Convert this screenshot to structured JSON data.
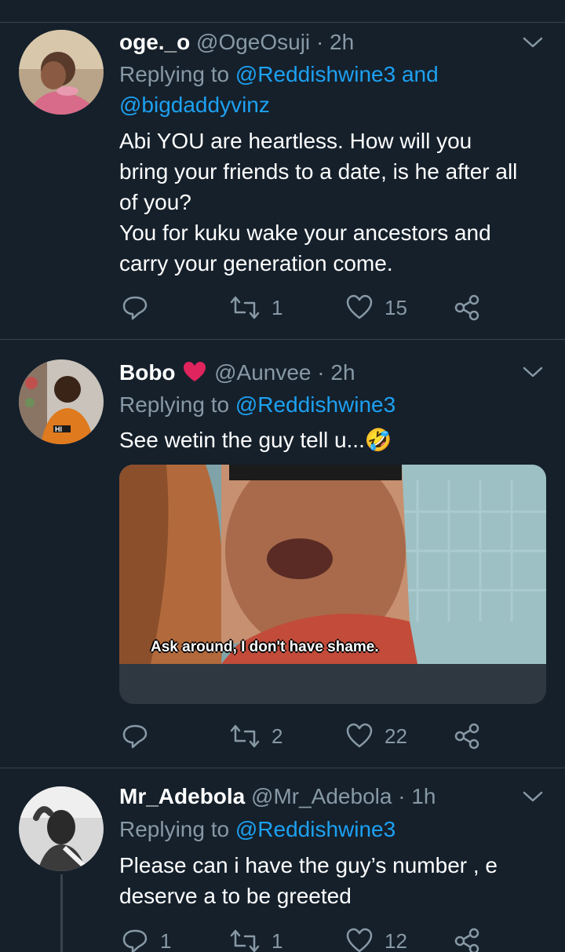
{
  "tweets": [
    {
      "name": "oge._o",
      "handle": "@OgeOsuji",
      "time": "· 2h",
      "replying_prefix": "Replying to ",
      "replying_mentions": "@Reddishwine3 and",
      "replying_mentions_2": "@bigdaddyvinz",
      "body": [
        "Abi YOU are heartless. How will you",
        "bring your friends to a date, is he after all",
        "of you?",
        "You for kuku wake your ancestors and",
        "carry your generation come."
      ],
      "retweets": "1",
      "likes": "15",
      "replies": ""
    },
    {
      "name": "Bobo",
      "name_emoji": "❤️",
      "handle": "@Aunvee",
      "time": "· 2h",
      "replying_prefix": "Replying to ",
      "replying_mentions": "@Reddishwine3",
      "body": [
        "See wetin the guy tell u...🤣"
      ],
      "media_caption": "Ask around, I don't have shame.",
      "retweets": "2",
      "likes": "22",
      "replies": ""
    },
    {
      "name": "Mr_Adebola",
      "handle": "@Mr_Adebola",
      "time": "· 1h",
      "replying_prefix": "Replying to ",
      "replying_mentions": "@Reddishwine3",
      "body": [
        "Please can i have the guy’s number , e",
        "deserve a to be greeted"
      ],
      "replies": "1",
      "retweets": "1",
      "likes": "12"
    }
  ],
  "colors": {
    "background": "#15202b",
    "secondary_text": "#8899a6",
    "link": "#1da1f2",
    "divider": "#38444d",
    "heart": "#e0245e"
  },
  "icons": [
    "reply-icon",
    "retweet-icon",
    "like-icon",
    "share-icon",
    "chevron-down-icon"
  ]
}
